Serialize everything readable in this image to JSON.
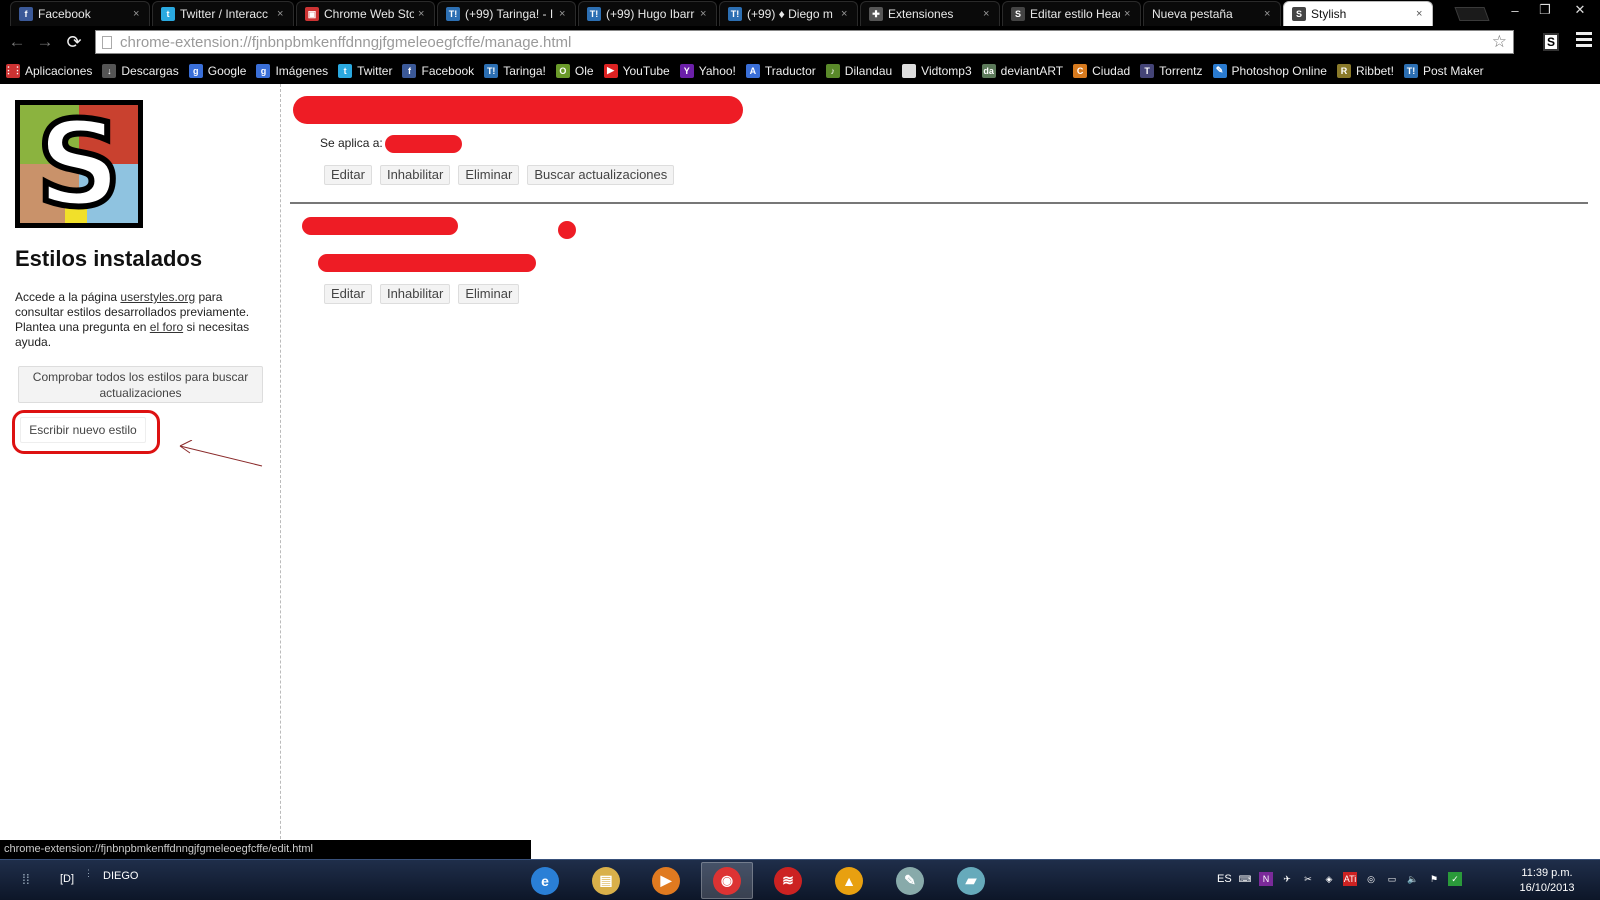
{
  "tabs": [
    {
      "title": "Facebook",
      "icon": "facebook-icon",
      "color": "#3b5998",
      "glyph": "f"
    },
    {
      "title": "Twitter / Interacc",
      "icon": "twitter-icon",
      "color": "#2aa9e0",
      "glyph": "t"
    },
    {
      "title": "Chrome Web Sto",
      "icon": "chrome-web-store-icon",
      "color": "#c33",
      "glyph": "▣"
    },
    {
      "title": "(+99) Taringa! - I",
      "icon": "taringa-icon",
      "color": "#2c6fb3",
      "glyph": "T!"
    },
    {
      "title": "(+99) Hugo Ibarr",
      "icon": "taringa-icon",
      "color": "#2c6fb3",
      "glyph": "T!"
    },
    {
      "title": "(+99) ♦ Diego m",
      "icon": "taringa-icon",
      "color": "#2c6fb3",
      "glyph": "T!"
    },
    {
      "title": "Extensiones",
      "icon": "puzzle-icon",
      "color": "#555",
      "glyph": "✚"
    },
    {
      "title": "Editar estilo Heac",
      "icon": "stylish-icon",
      "color": "#444",
      "glyph": "S"
    },
    {
      "title": "Nueva pestaña",
      "icon": "",
      "color": "",
      "glyph": ""
    },
    {
      "title": "Stylish",
      "icon": "stylish-icon",
      "color": "#444",
      "glyph": "S"
    }
  ],
  "toolbar": {
    "url": "chrome-extension://fjnbnpbmkenffdnngjfgmeleoegfcffe/manage.html"
  },
  "bookmarks": [
    {
      "label": "Aplicaciones",
      "icon": "apps-grid-icon",
      "color": "#c33",
      "glyph": "⋮⋮"
    },
    {
      "label": "Descargas",
      "icon": "download-icon",
      "color": "#555",
      "glyph": "↓"
    },
    {
      "label": "Google",
      "icon": "google-icon",
      "color": "#3a6fd8",
      "glyph": "g"
    },
    {
      "label": "Imágenes",
      "icon": "google-icon",
      "color": "#3a6fd8",
      "glyph": "g"
    },
    {
      "label": "Twitter",
      "icon": "twitter-icon",
      "color": "#2aa9e0",
      "glyph": "t"
    },
    {
      "label": "Facebook",
      "icon": "facebook-icon",
      "color": "#3b5998",
      "glyph": "f"
    },
    {
      "label": "Taringa!",
      "icon": "taringa-icon",
      "color": "#2c6fb3",
      "glyph": "T!"
    },
    {
      "label": "Ole",
      "icon": "ole-icon",
      "color": "#6a9a2a",
      "glyph": "O"
    },
    {
      "label": "YouTube",
      "icon": "youtube-icon",
      "color": "#d22",
      "glyph": "▶"
    },
    {
      "label": "Yahoo!",
      "icon": "yahoo-icon",
      "color": "#6b1fa8",
      "glyph": "Y"
    },
    {
      "label": "Traductor",
      "icon": "translate-icon",
      "color": "#3a6fd8",
      "glyph": "A"
    },
    {
      "label": "Dilandau",
      "icon": "dilandau-icon",
      "color": "#5a8a2a",
      "glyph": "♪"
    },
    {
      "label": "Vidtomp3",
      "icon": "page-icon",
      "color": "#ddd",
      "glyph": ""
    },
    {
      "label": "deviantART",
      "icon": "deviantart-icon",
      "color": "#5c7a5a",
      "glyph": "da"
    },
    {
      "label": "Ciudad",
      "icon": "ciudad-icon",
      "color": "#d77a1e",
      "glyph": "C"
    },
    {
      "label": "Torrentz",
      "icon": "torrentz-icon",
      "color": "#447",
      "glyph": "T"
    },
    {
      "label": "Photoshop Online",
      "icon": "feather-icon",
      "color": "#2a7bd0",
      "glyph": "✎"
    },
    {
      "label": "Ribbet!",
      "icon": "ribbet-icon",
      "color": "#8a7a2a",
      "glyph": "R"
    },
    {
      "label": "Post Maker",
      "icon": "taringa-icon",
      "color": "#2c6fb3",
      "glyph": "T!"
    }
  ],
  "sidebar": {
    "title": "Estilos instalados",
    "intro_1": "Accede a la página ",
    "intro_link_1": "userstyles.org",
    "intro_2": " para consultar estilos desarrollados previamente. Plantea una pregunta en ",
    "intro_link_2": "el foro",
    "intro_3": " si necesitas ayuda.",
    "check_all_label": "Comprobar todos los estilos para buscar actualizaciones",
    "new_style_label": "Escribir nuevo estilo"
  },
  "styles": [
    {
      "applies_label": "Se aplica a:",
      "buttons": [
        "Editar",
        "Inhabilitar",
        "Eliminar",
        "Buscar actualizaciones"
      ]
    },
    {
      "buttons": [
        "Editar",
        "Inhabilitar",
        "Eliminar"
      ]
    }
  ],
  "status_url": "chrome-extension://fjnbnpbmkenffdnngjfgmeleoegfcffe/edit.html",
  "taskbar": {
    "drive_label": "[D]",
    "user_label": "DIEGO",
    "lang": "ES",
    "time": "11:39 p.m.",
    "date": "16/10/2013",
    "apps": [
      {
        "name": "internet-explorer-icon",
        "color": "#2a7fd6",
        "glyph": "e"
      },
      {
        "name": "file-explorer-icon",
        "color": "#d9b04a",
        "glyph": "▤"
      },
      {
        "name": "media-player-icon",
        "color": "#e07a20",
        "glyph": "▶"
      },
      {
        "name": "chrome-icon",
        "color": "#d33",
        "glyph": "◉"
      },
      {
        "name": "app-swirl-icon",
        "color": "#c22",
        "glyph": "≋"
      },
      {
        "name": "vlc-icon",
        "color": "#e8a010",
        "glyph": "▲"
      },
      {
        "name": "paint-icon",
        "color": "#8aa",
        "glyph": "✎"
      },
      {
        "name": "notes-icon",
        "color": "#6ab",
        "glyph": "▰"
      }
    ]
  },
  "colors": {
    "redaction": "#ee1c25",
    "logo_green": "#8bb33f",
    "logo_red": "#c9412f",
    "logo_tan": "#c9926a",
    "logo_blue": "#8fc3e0",
    "logo_yellow": "#f1e02a"
  }
}
